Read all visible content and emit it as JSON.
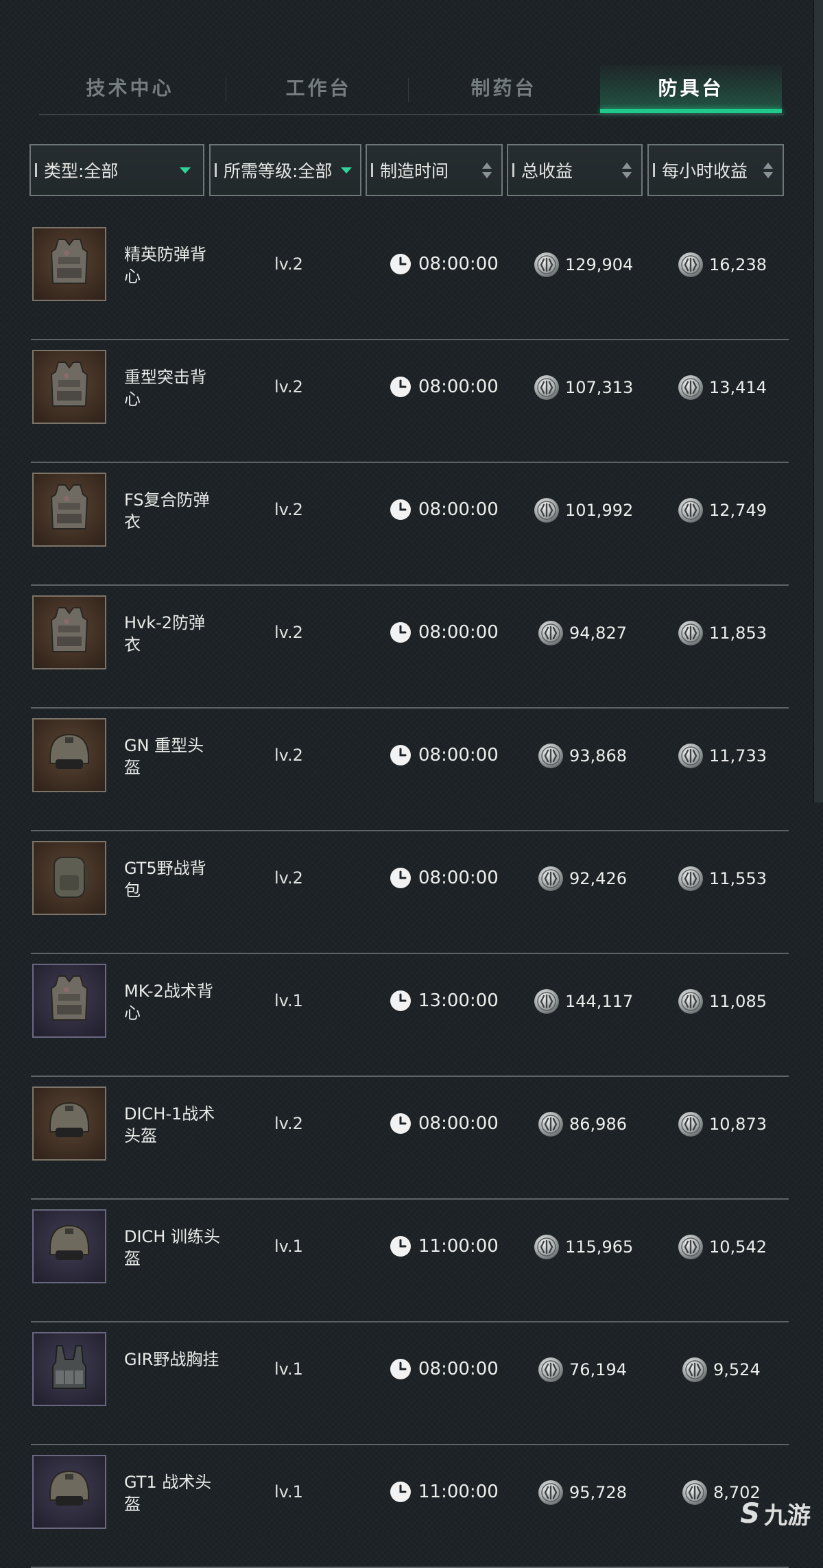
{
  "tabs": [
    {
      "label": "技术中心",
      "active": false
    },
    {
      "label": "工作台",
      "active": false
    },
    {
      "label": "制药台",
      "active": false
    },
    {
      "label": "防具台",
      "active": true
    }
  ],
  "filters": {
    "type": "类型:全部",
    "level": "所需等级:全部",
    "craft_time": "制造时间",
    "total_profit": "总收益",
    "hourly_profit": "每小时收益"
  },
  "accent_color": "#22c98c",
  "items": [
    {
      "name": "精英防弹背心",
      "level": "lv.2",
      "time": "08:00:00",
      "total": "129,904",
      "hourly": "16,238",
      "icon": "vest-icon",
      "rarity": "brown"
    },
    {
      "name": "重型突击背心",
      "level": "lv.2",
      "time": "08:00:00",
      "total": "107,313",
      "hourly": "13,414",
      "icon": "vest-icon",
      "rarity": "brown"
    },
    {
      "name": "FS复合防弹衣",
      "level": "lv.2",
      "time": "08:00:00",
      "total": "101,992",
      "hourly": "12,749",
      "icon": "vest-icon",
      "rarity": "brown"
    },
    {
      "name": "Hvk-2防弹衣",
      "level": "lv.2",
      "time": "08:00:00",
      "total": "94,827",
      "hourly": "11,853",
      "icon": "vest-icon",
      "rarity": "brown"
    },
    {
      "name": "GN 重型头盔",
      "level": "lv.2",
      "time": "08:00:00",
      "total": "93,868",
      "hourly": "11,733",
      "icon": "helmet-icon",
      "rarity": "brown"
    },
    {
      "name": "GT5野战背包",
      "level": "lv.2",
      "time": "08:00:00",
      "total": "92,426",
      "hourly": "11,553",
      "icon": "backpack-icon",
      "rarity": "brown"
    },
    {
      "name": "MK-2战术背心",
      "level": "lv.1",
      "time": "13:00:00",
      "total": "144,117",
      "hourly": "11,085",
      "icon": "vest-icon",
      "rarity": "purple"
    },
    {
      "name": "DICH-1战术头盔",
      "level": "lv.2",
      "time": "08:00:00",
      "total": "86,986",
      "hourly": "10,873",
      "icon": "helmet-icon",
      "rarity": "brown"
    },
    {
      "name": "DICH 训练头盔",
      "level": "lv.1",
      "time": "11:00:00",
      "total": "115,965",
      "hourly": "10,542",
      "icon": "helmet-icon",
      "rarity": "purple"
    },
    {
      "name": "GIR野战胸挂",
      "level": "lv.1",
      "time": "08:00:00",
      "total": "76,194",
      "hourly": "9,524",
      "icon": "chest-rig-icon",
      "rarity": "purple"
    },
    {
      "name": "GT1 战术头盔",
      "level": "lv.1",
      "time": "11:00:00",
      "total": "95,728",
      "hourly": "8,702",
      "icon": "helmet-icon",
      "rarity": "purple"
    }
  ],
  "watermark": {
    "mark": "S",
    "text": "九游"
  }
}
